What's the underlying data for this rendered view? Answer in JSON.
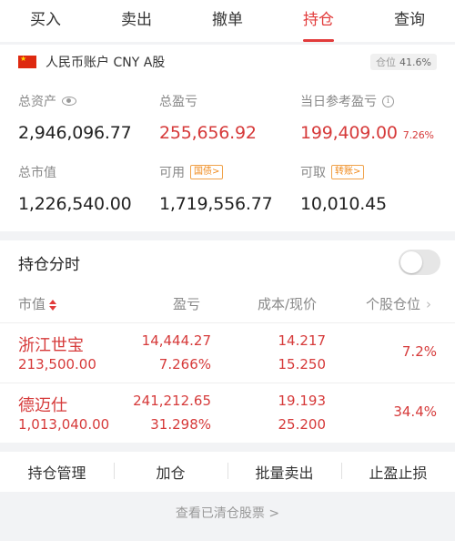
{
  "tabs": [
    {
      "label": "买入",
      "active": false
    },
    {
      "label": "卖出",
      "active": false
    },
    {
      "label": "撤单",
      "active": false
    },
    {
      "label": "持仓",
      "active": true
    },
    {
      "label": "查询",
      "active": false
    }
  ],
  "account": {
    "name": "人民币账户 CNY A股",
    "position_label": "仓位",
    "position_value": "41.6%"
  },
  "summary": {
    "total_assets": {
      "label": "总资产",
      "value": "2,946,096.77"
    },
    "total_profit": {
      "label": "总盈亏",
      "value": "255,656.92"
    },
    "daily_profit": {
      "label": "当日参考盈亏",
      "value": "199,409.00",
      "pct": "7.26%"
    },
    "market_value": {
      "label": "总市值",
      "value": "1,226,540.00"
    },
    "available": {
      "label": "可用",
      "chip": "国债>",
      "value": "1,719,556.77"
    },
    "withdrawable": {
      "label": "可取",
      "chip": "转账>",
      "value": "10,010.45"
    }
  },
  "holdings": {
    "title": "持仓分时",
    "toggle_on": false,
    "columns": {
      "market": "市值",
      "profit": "盈亏",
      "cost": "成本/现价",
      "position": "个股仓位"
    },
    "rows": [
      {
        "name": "浙江世宝",
        "market_value": "213,500.00",
        "profit": "14,444.27",
        "profit_pct": "7.266%",
        "cost": "14.217",
        "price": "15.250",
        "position": "7.2%"
      },
      {
        "name": "德迈仕",
        "market_value": "1,013,040.00",
        "profit": "241,212.65",
        "profit_pct": "31.298%",
        "cost": "19.193",
        "price": "25.200",
        "position": "34.4%"
      }
    ]
  },
  "actions": [
    "持仓管理",
    "加仓",
    "批量卖出",
    "止盈止损"
  ],
  "cleared_link": "查看已清仓股票 >",
  "colors": {
    "accent": "#e23b3b",
    "profit": "#d63a3a",
    "chip": "#f08a1c"
  },
  "icons": [
    "china-flag-icon",
    "eye-icon",
    "info-icon",
    "sort-icon",
    "chevron-right-icon"
  ]
}
